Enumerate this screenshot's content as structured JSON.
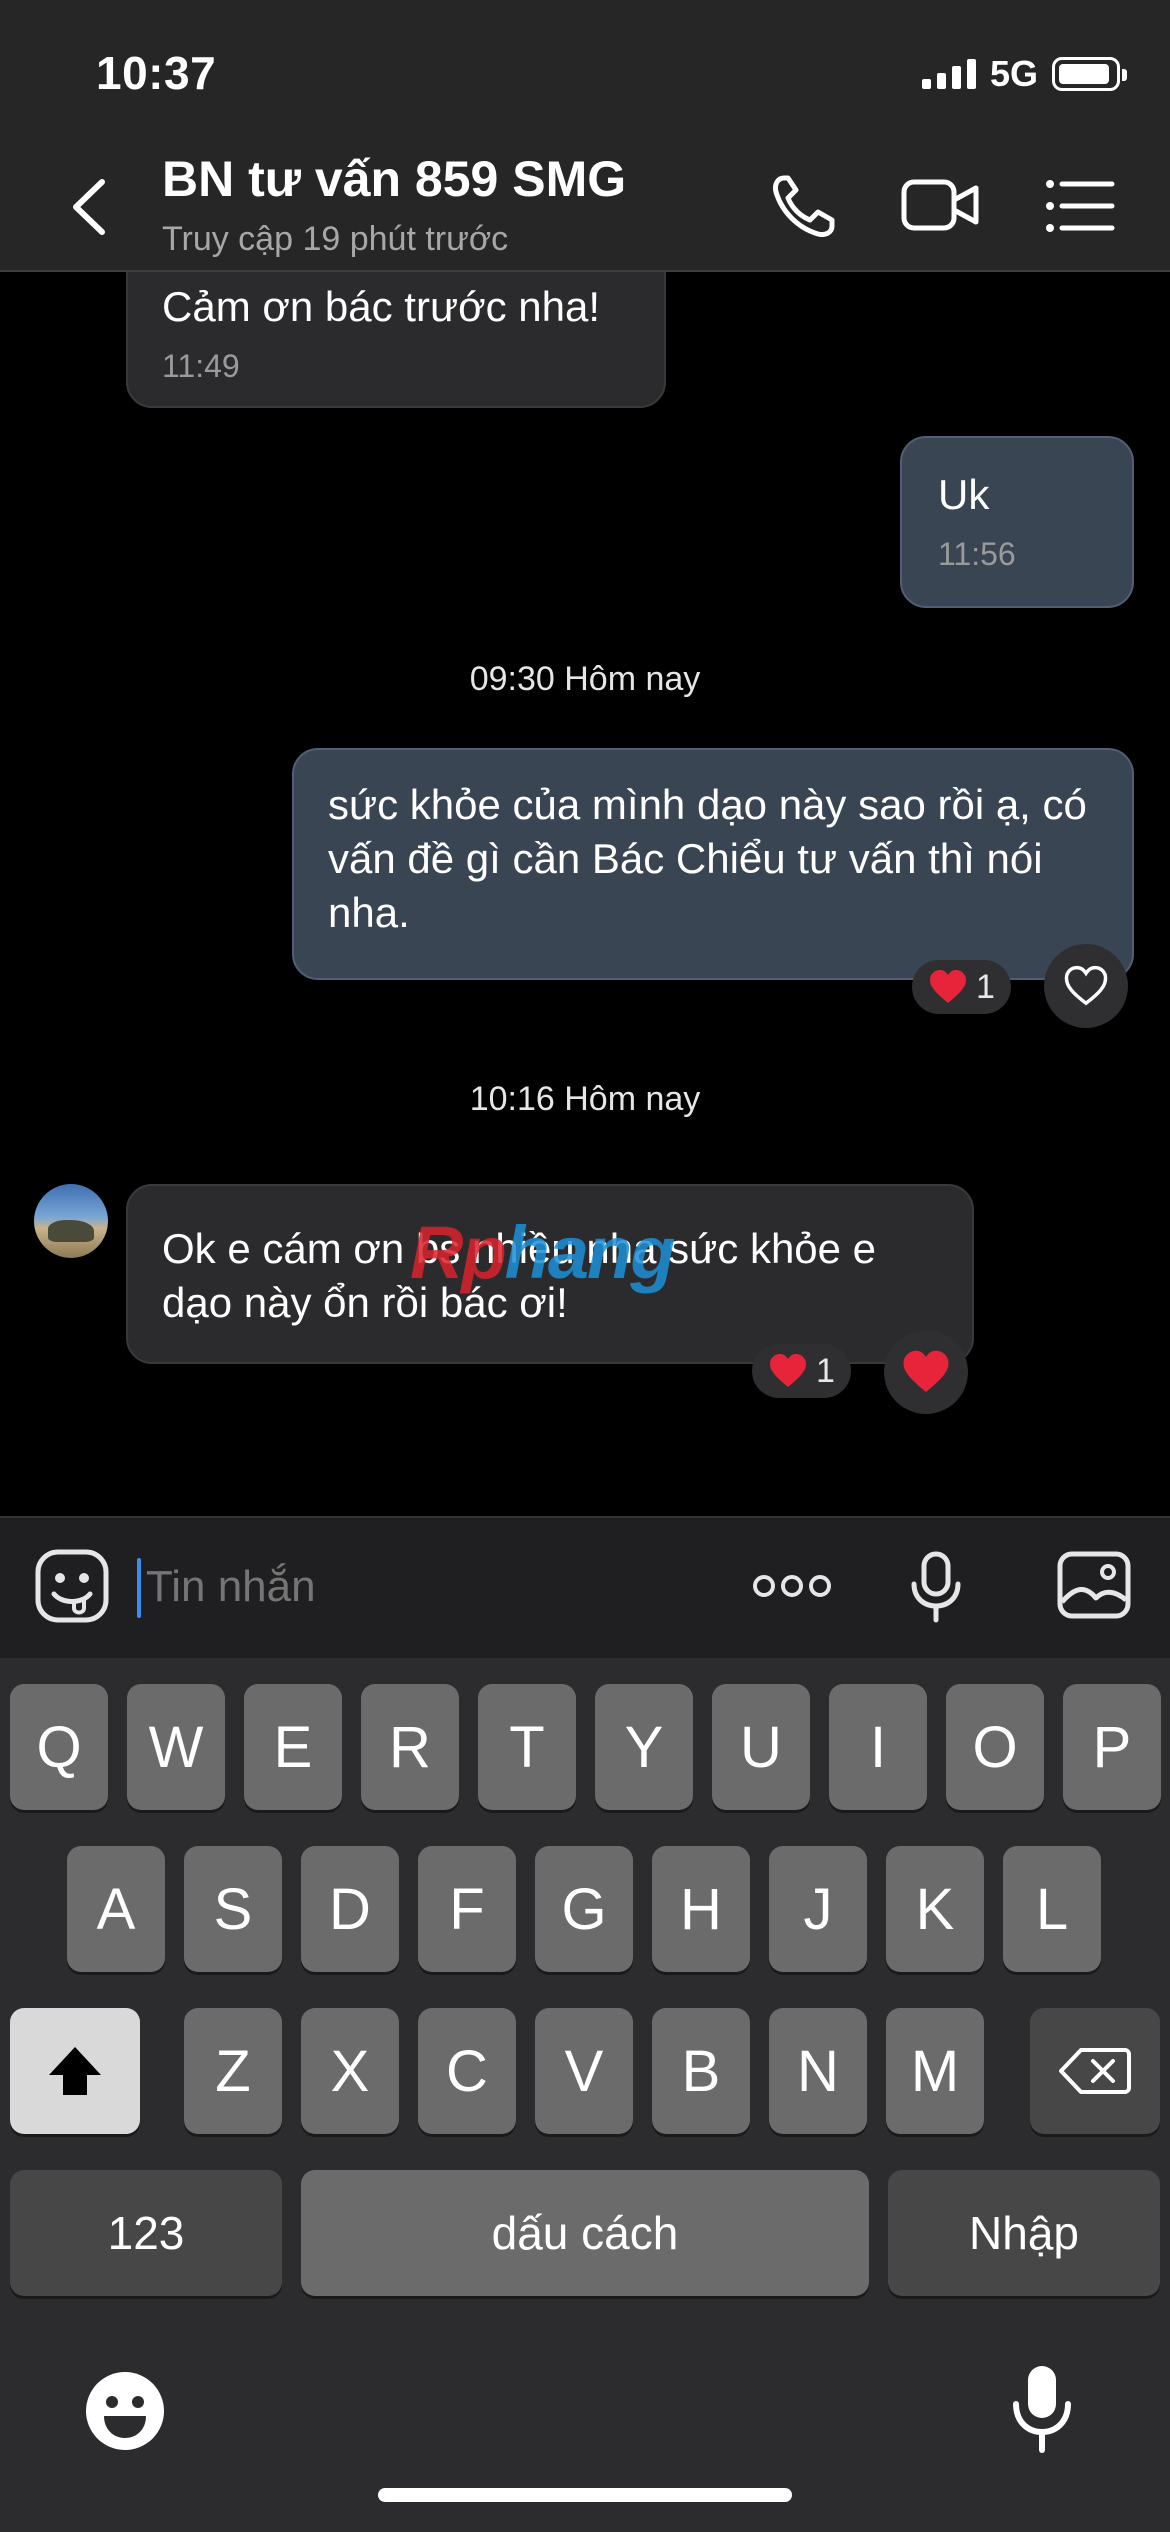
{
  "status_bar": {
    "time": "10:37",
    "network": "5G"
  },
  "header": {
    "title": "BN tư vấn 859 SMG",
    "subtitle": "Truy cập 19 phút trước",
    "icons": [
      "chevron-left-icon",
      "phone-icon",
      "video-camera-icon",
      "menu-list-icon"
    ]
  },
  "messages": [
    {
      "direction": "in",
      "text": "Cảm ơn bác trước nha!",
      "time": "11:49"
    },
    {
      "direction": "out",
      "text": "Uk",
      "time": "11:56"
    },
    {
      "type": "separator",
      "text": "09:30 Hôm nay"
    },
    {
      "direction": "out",
      "text": "sức khỏe của mình dạo này sao rồi ạ, có vấn đề gì cần Bác Chiểu tư vấn thì nói nha.",
      "reaction_count": "1"
    },
    {
      "type": "separator",
      "text": "10:16 Hôm nay"
    },
    {
      "direction": "in",
      "text": "Ok e cám ơn bs nhiều nha sức khỏe e dạo này ổn rồi bác ơi!",
      "reaction_count": "1"
    }
  ],
  "watermark": {
    "part1": "Rp",
    "part2": "hang"
  },
  "input": {
    "placeholder": "Tin nhắn"
  },
  "keyboard": {
    "row1": [
      "Q",
      "W",
      "E",
      "R",
      "T",
      "Y",
      "U",
      "I",
      "O",
      "P"
    ],
    "row2": [
      "A",
      "S",
      "D",
      "F",
      "G",
      "H",
      "J",
      "K",
      "L"
    ],
    "row3": [
      "Z",
      "X",
      "C",
      "V",
      "B",
      "N",
      "M"
    ],
    "numbers_label": "123",
    "space_label": "dấu cách",
    "return_label": "Nhập"
  },
  "colors": {
    "accent": "#3a8df0",
    "heart": "#e8243a",
    "outgoing_bubble": "#3a4553",
    "incoming_bubble": "#2b2b2d"
  }
}
